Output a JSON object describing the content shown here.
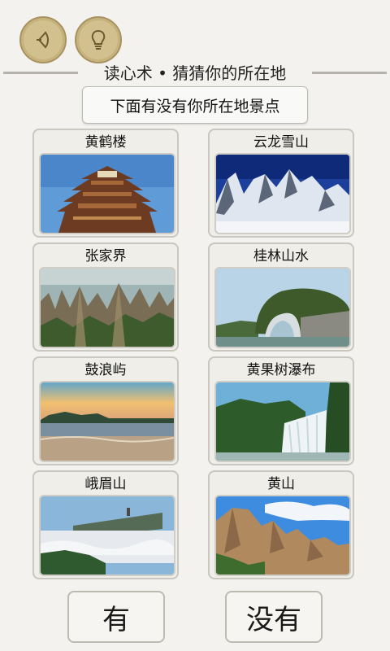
{
  "header": {
    "back_icon": "back-arrow-icon",
    "hint_icon": "lightbulb-icon",
    "title": "读心术 • 猜猜你的所在地"
  },
  "question": "下面有没有你所在地景点",
  "places": [
    {
      "label": "黄鹤楼"
    },
    {
      "label": "云龙雪山"
    },
    {
      "label": "张家界"
    },
    {
      "label": "桂林山水"
    },
    {
      "label": "鼓浪屿"
    },
    {
      "label": "黄果树瀑布"
    },
    {
      "label": "峨眉山"
    },
    {
      "label": "黄山"
    }
  ],
  "buttons": {
    "yes": "有",
    "no": "没有"
  },
  "colors": {
    "accent": "#d2c08e",
    "background": "#f3f2ee"
  }
}
